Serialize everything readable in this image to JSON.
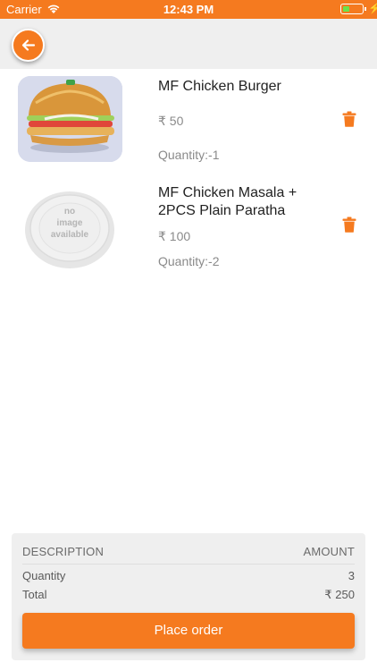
{
  "status_bar": {
    "carrier": "Carrier",
    "time": "12:43 PM",
    "battery_level": 0.35
  },
  "colors": {
    "accent": "#f57a1f",
    "battery_fill": "#6be34c"
  },
  "nav": {
    "back_icon": "arrow-left-icon"
  },
  "items": [
    {
      "name": "MF Chicken Burger",
      "price": "₹ 50",
      "quantity": "Quantity:-1",
      "image": "burger-photo",
      "delete_icon": "trash-icon"
    },
    {
      "name": "MF Chicken Masala + 2PCS Plain Paratha",
      "price": "₹ 100",
      "quantity": "Quantity:-2",
      "image": "no-image-placeholder",
      "image_text": [
        "no",
        "image",
        "available"
      ],
      "delete_icon": "trash-icon"
    }
  ],
  "summary": {
    "description_header": "DESCRIPTION",
    "amount_header": "AMOUNT",
    "quantity_label": "Quantity",
    "quantity_value": "3",
    "total_label": "Total",
    "total_value": "₹ 250"
  },
  "place_order_label": "Place order"
}
